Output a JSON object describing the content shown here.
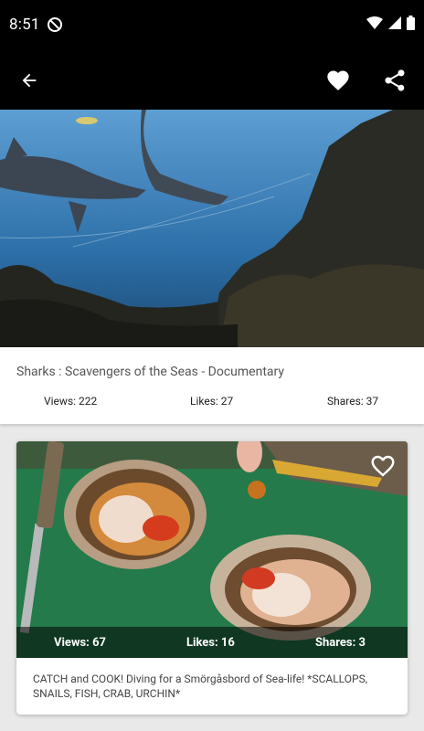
{
  "status_bar": {
    "time": "8:51",
    "icons": [
      "do-not-disturb-icon",
      "wifi-icon",
      "signal-icon",
      "battery-icon"
    ]
  },
  "toolbar": {
    "back_icon": "arrow-left-icon",
    "favorite_icon": "heart-icon",
    "share_icon": "share-icon"
  },
  "featured": {
    "title": "Sharks : Scavengers of the Seas - Documentary",
    "views": "Views: 222",
    "likes": "Likes: 27",
    "shares": "Shares: 37"
  },
  "list": [
    {
      "title": "CATCH and COOK! Diving for a Smörgåsbord of Sea-life! *SCALLOPS, SNAILS, FISH, CRAB, URCHIN*",
      "views": "Views: 67",
      "likes": "Likes: 16",
      "shares": "Shares: 3"
    }
  ],
  "colors": {
    "bar": "#000000",
    "background": "#e9e9e9",
    "card": "#ffffff",
    "overlay": "rgba(0,0,0,0.55)"
  }
}
